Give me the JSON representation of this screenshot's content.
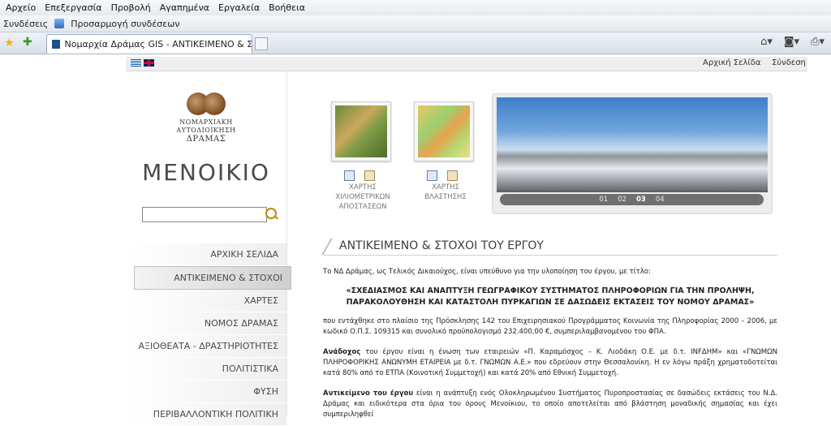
{
  "browser": {
    "menu": [
      "Αρχείο",
      "Επεξεργασία",
      "Προβολή",
      "Αγαπημένα",
      "Εργαλεία",
      "Βοήθεια"
    ],
    "links_label": "Συνδέσεις",
    "links_item": "Προσαρμογή συνδέσεων",
    "tab_title": "Νομαρχία Δράμας GIS - ΑΝΤΙΚΕΙΜΕΝΟ & ΣΤΟΧΟΙ"
  },
  "site": {
    "top_links": {
      "home": "Αρχική Σελίδα",
      "login": "Σύνδεση"
    },
    "logo": {
      "line1": "ΝΟΜΑΡΧΙΑΚΗ",
      "line2": "ΑΥΤΟΔΙΟΙΚΗΣΗ",
      "line3": "ΔΡΑΜΑΣ",
      "big": "ΜΕΝΟΙΚΙΟ"
    },
    "nav": [
      "ΑΡΧΙΚΗ ΣΕΛΙΔΑ",
      "ΑΝΤΙΚΕΙΜΕΝΟ & ΣΤΟΧΟΙ",
      "ΧΑΡΤΕΣ",
      "ΝΟΜΟΣ ΔΡΑΜΑΣ",
      "ΑΞΙΟΘΕΑΤΑ - ΔΡΑΣΤΗΡΙΟΤΗΤΕΣ",
      "ΠΟΛΙΤΙΣΤΙΚΑ",
      "ΦΥΣΗ",
      "ΠΕΡΙΒΑΛΛΟΝΤΙΚΗ ΠΟΛΙΤΙΚΗ"
    ],
    "active_nav": 1,
    "maps": [
      {
        "l1": "ΧΑΡΤΗΣ",
        "l2": "ΧΙΛΙΟΜΕΤΡΙΚΩΝ",
        "l3": "ΑΠΟΣΤΑΣΕΩΝ"
      },
      {
        "l1": "ΧΑΡΤΗΣ",
        "l2": "ΒΛΑΣΤΗΣΗΣ",
        "l3": ""
      }
    ],
    "slides": [
      "01",
      "02",
      "03",
      "04"
    ],
    "current_slide": 2,
    "section_title": "ΑΝΤΙΚΕΙΜΕΝΟ & ΣΤΟΧΟΙ ΤΟΥ ΕΡΓΟΥ",
    "intro": "Το ΝΔ Δράμας, ως Τελικός Δικαιούχος, είναι υπεύθυνο για την υλοποίηση του έργου, με τίτλο:",
    "project_title_1": "«ΣΧΕΔΙΑΣΜΟΣ ΚΑΙ ΑΝΑΠΤΥΞΗ ΓΕΩΓΡΑΦΙΚΟΥ ΣΥΣΤΗΜΑΤΟΣ ΠΛΗΡΟΦΟΡΙΩΝ ΓΙΑ ΤΗΝ ΠΡΟΛΗΨΗ,",
    "project_title_2": "ΠΑΡΑΚΟΛΟΥΘΗΣΗ ΚΑΙ ΚΑΤΑΣΤΟΛΗ ΠΥΡΚΑΓΙΩΝ ΣΕ ΔΑΣΩΔΕΙΣ ΕΚΤΑΣΕΙΣ ΤΟΥ ΝΟΜΟΥ ΔΡΑΜΑΣ»",
    "para1": "που εντάχθηκε στο πλαίσιο της Πρόσκλησης 142 του Επιχειρησιακού Προγράμματος Κοινωνία της Πληροφορίας 2000 – 2006, με κωδικό Ο.Π.Σ. 109315 και συνολικό προϋπολογισμό 232.400,00 €, συμπεριλαμβανομένου του ΦΠΑ.",
    "para2_label": "Ανάδοχος",
    "para2": " του έργου είναι η ένωση των εταιρειών «Π. Καραμόσχος – Κ. Λιοδάκη Ο.Ε. με δ.τ. INFΔΗΜ» και «ΓΝΩΜΩΝ ΠΛΗΡΟΦΟΡΙΚΗΣ ΑΝΩΝΥΜΗ ΕΤΑΙΡΕΙΑ με δ.τ. ΓΝΩΜΩΝ Α.Ε.» που εδρεύουν στην Θεσσαλονίκη. Η εν λόγω πράξη χρηματοδοτείται κατά 80% από το ΕΤΠΑ (Κοινοτική Συμμετοχή) και κατά 20% από Εθνική Συμμετοχή.",
    "para3_label": "Αντικείμενο του έργου",
    "para3": " είναι η ανάπτυξη ενός Ολοκληρωμένου Συστήματος Πυροπροστασίας σε δασώδεις εκτάσεις του Ν.Δ. Δράμας και ειδικότερα στα όρια του όρους Μενοίκιου, το οποίο αποτελείται από βλάστηση μοναδικής σημασίας και έχει συμπεριληφθεί"
  }
}
